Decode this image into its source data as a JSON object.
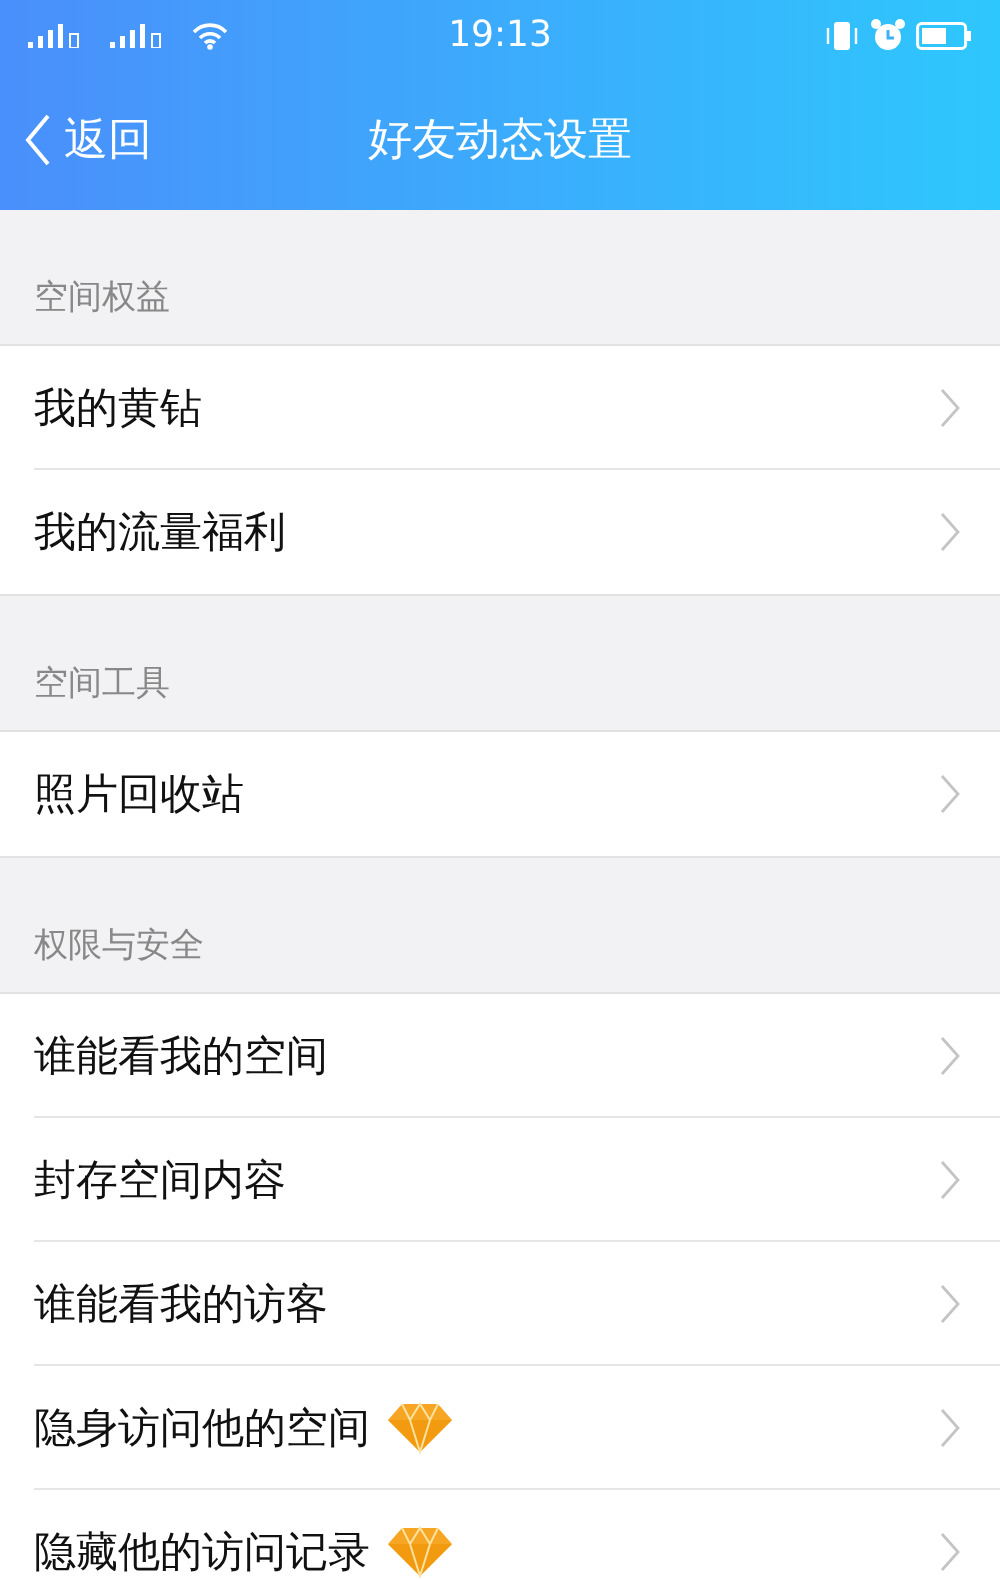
{
  "status_bar": {
    "time": "19:13"
  },
  "nav_bar": {
    "back_label": "返回",
    "title": "好友动态设置"
  },
  "sections": [
    {
      "title": "空间权益",
      "items": [
        {
          "label": "我的黄钻",
          "vip": false
        },
        {
          "label": "我的流量福利",
          "vip": false
        }
      ]
    },
    {
      "title": "空间工具",
      "items": [
        {
          "label": "照片回收站",
          "vip": false
        }
      ]
    },
    {
      "title": "权限与安全",
      "items": [
        {
          "label": "谁能看我的空间",
          "vip": false
        },
        {
          "label": "封存空间内容",
          "vip": false
        },
        {
          "label": "谁能看我的访客",
          "vip": false
        },
        {
          "label": "隐身访问他的空间",
          "vip": true
        },
        {
          "label": "隐藏他的访问记录",
          "vip": true
        }
      ]
    }
  ]
}
